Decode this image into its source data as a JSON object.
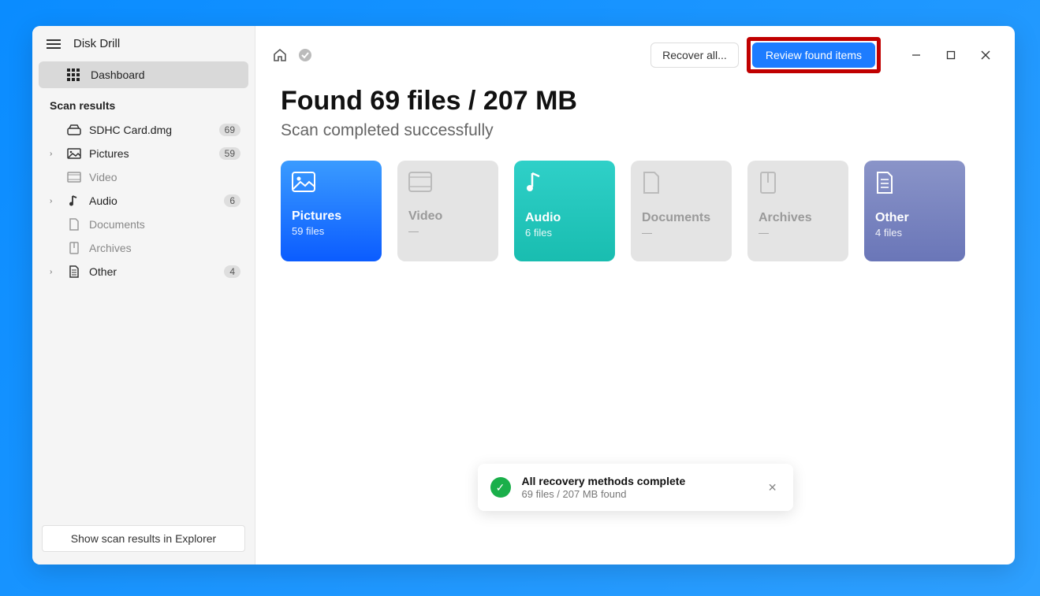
{
  "app": {
    "title": "Disk Drill"
  },
  "sidebar": {
    "dashboard_label": "Dashboard",
    "section_label": "Scan results",
    "items": [
      {
        "label": "SDHC Card.dmg",
        "count": "69",
        "icon": "drive",
        "expandable": false
      },
      {
        "label": "Pictures",
        "count": "59",
        "icon": "image",
        "expandable": true
      },
      {
        "label": "Video",
        "count": "",
        "icon": "video",
        "expandable": false
      },
      {
        "label": "Audio",
        "count": "6",
        "icon": "audio",
        "expandable": true
      },
      {
        "label": "Documents",
        "count": "",
        "icon": "document",
        "expandable": false
      },
      {
        "label": "Archives",
        "count": "",
        "icon": "archive",
        "expandable": false
      },
      {
        "label": "Other",
        "count": "4",
        "icon": "other",
        "expandable": true
      }
    ],
    "footer_button": "Show scan results in Explorer"
  },
  "topbar": {
    "recover_label": "Recover all...",
    "review_label": "Review found items"
  },
  "results": {
    "heading": "Found 69 files / 207 MB",
    "subheading": "Scan completed successfully",
    "tiles": [
      {
        "label": "Pictures",
        "count": "59 files",
        "style": "pictures"
      },
      {
        "label": "Video",
        "count": "—",
        "style": "disabled"
      },
      {
        "label": "Audio",
        "count": "6 files",
        "style": "audio"
      },
      {
        "label": "Documents",
        "count": "—",
        "style": "disabled"
      },
      {
        "label": "Archives",
        "count": "—",
        "style": "disabled"
      },
      {
        "label": "Other",
        "count": "4 files",
        "style": "other"
      }
    ]
  },
  "toast": {
    "title": "All recovery methods complete",
    "subtitle": "69 files / 207 MB found"
  }
}
